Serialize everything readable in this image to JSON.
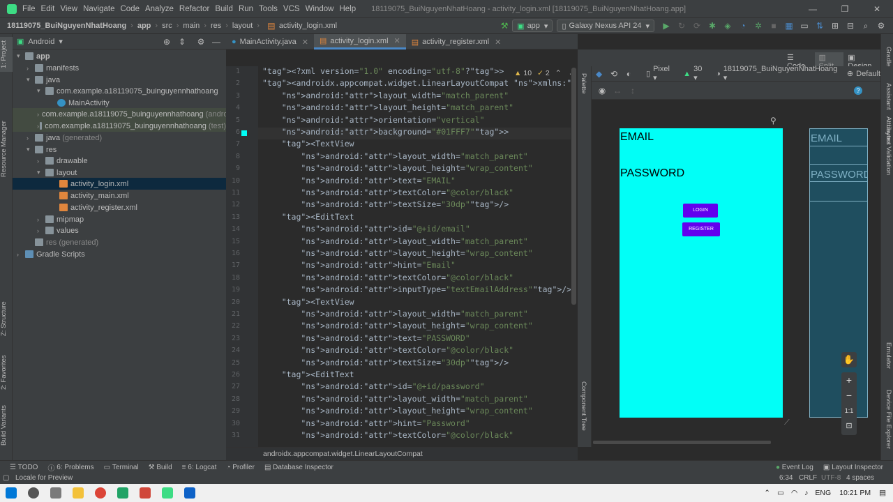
{
  "window": {
    "menu": [
      "File",
      "Edit",
      "View",
      "Navigate",
      "Code",
      "Analyze",
      "Refactor",
      "Build",
      "Run",
      "Tools",
      "VCS",
      "Window",
      "Help"
    ],
    "title": "18119075_BuiNguyenNhatHoang - activity_login.xml [18119075_BuiNguyenNhatHoang.app]"
  },
  "navbar": {
    "crumbs": [
      "18119075_BuiNguyenNhatHoang",
      "app",
      "src",
      "main",
      "res",
      "layout",
      "activity_login.xml"
    ],
    "run_config": "app",
    "device": "Galaxy Nexus API 24"
  },
  "project": {
    "view_label": "Android",
    "tree": [
      {
        "label": "app",
        "type": "folder"
      },
      {
        "label": "manifests",
        "type": "folder"
      },
      {
        "label": "java",
        "type": "folder"
      },
      {
        "label": "com.example.a18119075_buinguyennhathoang",
        "type": "pkg"
      },
      {
        "label": "MainActivity",
        "type": "class"
      },
      {
        "label": "com.example.a18119075_buinguyennhathoang",
        "suffix": "(androidTest)",
        "type": "pkg"
      },
      {
        "label": "com.example.a18119075_buinguyennhathoang",
        "suffix": "(test)",
        "type": "pkg"
      },
      {
        "label": "java",
        "suffix": "(generated)",
        "type": "folder"
      },
      {
        "label": "res",
        "type": "folder"
      },
      {
        "label": "drawable",
        "type": "folder"
      },
      {
        "label": "layout",
        "type": "folder"
      },
      {
        "label": "activity_login.xml",
        "type": "xml"
      },
      {
        "label": "activity_main.xml",
        "type": "xml"
      },
      {
        "label": "activity_register.xml",
        "type": "xml"
      },
      {
        "label": "mipmap",
        "type": "folder"
      },
      {
        "label": "values",
        "type": "folder"
      },
      {
        "label": "res (generated)",
        "type": "folder"
      },
      {
        "label": "Gradle Scripts",
        "type": "gradle"
      }
    ]
  },
  "left_tools": [
    "1: Project",
    "Resource Manager",
    "Z: Structure",
    "2: Favorites",
    "Build Variants"
  ],
  "right_tools": [
    "Gradle",
    "Assistant",
    "Attributes",
    "Layout Validation",
    "Emulator",
    "Device File Explorer"
  ],
  "tabs": [
    "MainActivity.java",
    "activity_login.xml",
    "activity_register.xml"
  ],
  "editor": {
    "warnings": "10",
    "weak_warnings": "2",
    "footer_path": "androidx.appcompat.widget.LinearLayoutCompat",
    "line_numbers": [
      "1",
      "2",
      "3",
      "4",
      "5",
      "6",
      "7",
      "8",
      "9",
      "10",
      "11",
      "12",
      "13",
      "14",
      "15",
      "16",
      "17",
      "18",
      "19",
      "20",
      "21",
      "22",
      "23",
      "24",
      "25",
      "26",
      "27",
      "28",
      "29",
      "30",
      "31"
    ],
    "lines": [
      "<?xml version=\"1.0\" encoding=\"utf-8\"?>",
      "<androidx.appcompat.widget.LinearLayoutCompat xmlns:android=\"http:/",
      "    android:layout_width=\"match_parent\"",
      "    android:layout_height=\"match_parent\"",
      "    android:orientation=\"vertical\"",
      "    android:background=\"#01FFF7\">",
      "    <TextView",
      "        android:layout_width=\"match_parent\"",
      "        android:layout_height=\"wrap_content\"",
      "        android:text=\"EMAIL\"",
      "        android:textColor=\"@color/black\"",
      "        android:textSize=\"30dp\"/>",
      "    <EditText",
      "        android:id=\"@+id/email\"",
      "        android:layout_width=\"match_parent\"",
      "        android:layout_height=\"wrap_content\"",
      "        android:hint=\"Email\"",
      "        android:textColor=\"@color/black\"",
      "        android:inputType=\"textEmailAddress\"/>",
      "    <TextView",
      "        android:layout_width=\"match_parent\"",
      "        android:layout_height=\"wrap_content\"",
      "        android:text=\"PASSWORD\"",
      "        android:textColor=\"@color/black\"",
      "        android:textSize=\"30dp\"/>",
      "    <EditText",
      "        android:id=\"@+id/password\"",
      "        android:layout_width=\"match_parent\"",
      "        android:layout_height=\"wrap_content\"",
      "        android:hint=\"Password\"",
      "        android:textColor=\"@color/black\""
    ]
  },
  "split": {
    "code": "Code",
    "split": "Split",
    "design": "Design"
  },
  "design_toolbar": {
    "device": "Pixel",
    "api": "30",
    "theme": "18119075_BuiNguyenNhatHoang",
    "locale": "Default"
  },
  "palette_label": "Palette",
  "component_tree_label": "Component Tree",
  "preview": {
    "background": "#01FFF7",
    "email_label": "EMAIL",
    "password_label": "PASSWORD",
    "login_button": "LOGIN",
    "register_button": "REGISTER",
    "button_color": "#6200EE"
  },
  "blueprint": {
    "email_label": "EMAIL",
    "password_label": "PASSWORD"
  },
  "zoom": {
    "fit": "1:1"
  },
  "bottom_tools": [
    "TODO",
    "6: Problems",
    "Terminal",
    "Build",
    "6: Logcat",
    "Profiler",
    "Database Inspector",
    "Event Log",
    "Layout Inspector"
  ],
  "status": {
    "message": "Locale for Preview",
    "position": "6:34",
    "line_sep": "CRLF",
    "encoding": "UTF-8",
    "indent": "4 spaces"
  },
  "taskbar": {
    "lang": "ENG",
    "time": "10:21 PM"
  }
}
